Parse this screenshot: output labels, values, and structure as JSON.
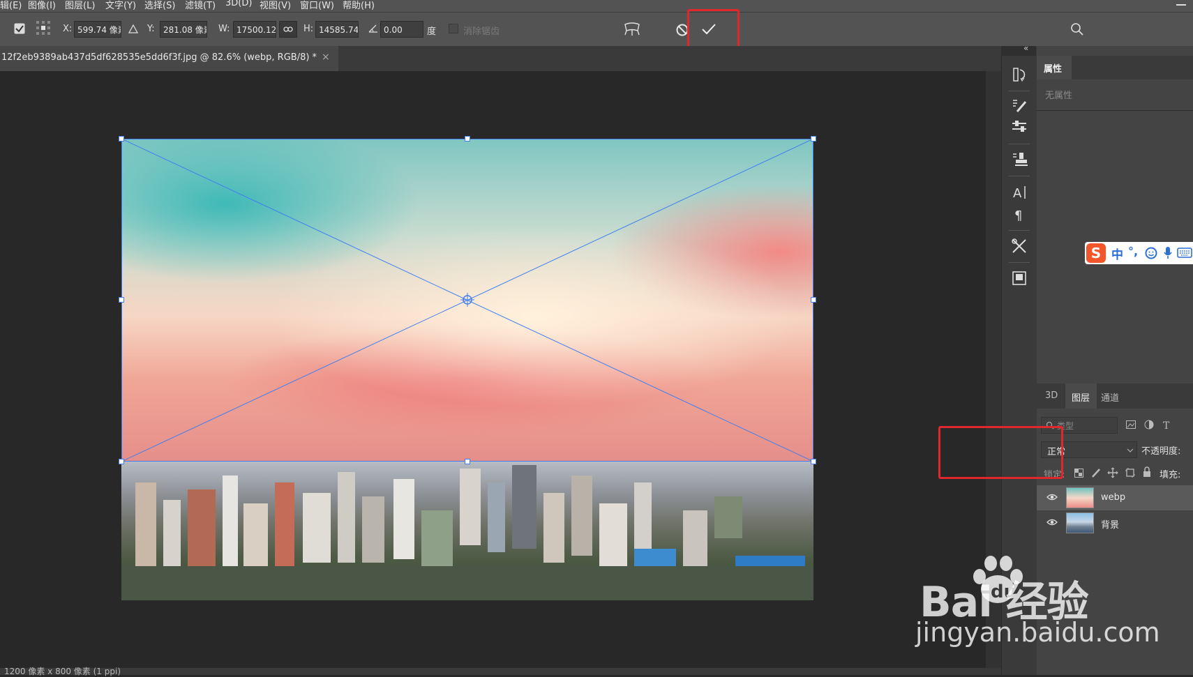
{
  "menu": {
    "items": [
      "辑(E)",
      "图像(I)",
      "图层(L)",
      "文字(Y)",
      "选择(S)",
      "滤镜(T)",
      "3D(D)",
      "视图(V)",
      "窗口(W)",
      "帮助(H)"
    ]
  },
  "options": {
    "x_label": "X:",
    "x_value": "599.74 像素",
    "y_label": "Y:",
    "y_value": "281.08 像素",
    "w_label": "W:",
    "w_value": "17500.12%",
    "h_label": "H:",
    "h_value": "14585.74%",
    "angle_value": "0.00",
    "angle_unit": "度",
    "antialias_label": "消除锯齿"
  },
  "document": {
    "tab_title": "12f2eb9389ab437d5df628535e5dd6f3f.jpg @ 82.6% (webp, RGB/8) *",
    "close_glyph": "×",
    "status": "1200 像素 x 800 像素 (1 ppi)"
  },
  "dock": {
    "collapse_glyph": "«"
  },
  "properties": {
    "tab_label": "属性",
    "empty_text": "无属性"
  },
  "layers": {
    "tabs": [
      "3D",
      "图层",
      "通道"
    ],
    "filter_placeholder": "类型",
    "blend_mode": "正常",
    "opacity_label": "不透明度:",
    "lock_label": "锁定:",
    "fill_label": "填充:",
    "items": [
      {
        "name": "webp",
        "selected": true
      },
      {
        "name": "背景",
        "selected": false
      }
    ]
  },
  "ime": {
    "logo": "S",
    "mode": "中",
    "punct": "°,"
  },
  "watermark": {
    "brand": "Bai 经验",
    "url": "jingyan.baidu.com"
  },
  "colors": {
    "accent_red": "#e0272b",
    "transform_blue": "#3f7ff0",
    "panel_bg": "#444444"
  }
}
